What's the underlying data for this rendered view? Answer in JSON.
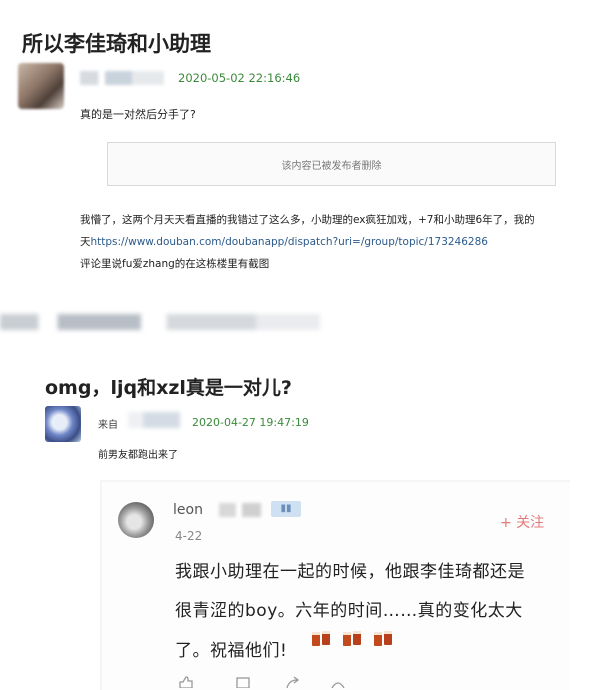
{
  "post1": {
    "title": "所以李佳琦和小助理",
    "timestamp": "2020-05-02 22:16:46",
    "comment": "真的是一对然后分手了?",
    "deleted_notice": "该内容已被发布者删除",
    "body_lines": [
      {
        "text": "我懵了，这两个月天天看直播的我错过了这么多，小助理的ex疯狂加戏，+7和小助理6年了，我的",
        "link": ""
      },
      {
        "text": "天",
        "link": "https://www.douban.com/doubanapp/dispatch?uri=/group/topic/173246286"
      },
      {
        "text": "评论里说fu爱zhang的在这栋楼里有截图",
        "link": ""
      }
    ]
  },
  "post2": {
    "title": "omg，ljq和xzl真是一对儿?",
    "from_label": "来自",
    "timestamp": "2020-04-27 19:47:19",
    "comment": "前男友都跑出来了"
  },
  "embedded_comment": {
    "username": "leon",
    "date": "4-22",
    "follow_label": "+ 关注",
    "lines": [
      "我跟小助理在一起的时候，他跟李佳琦都还是",
      "很青涩的boy。六年的时间……真的变化太大",
      "了。祝福他们!"
    ]
  },
  "colors": {
    "timestamp_green": "#3a8a3a",
    "link_blue": "#2b5a8c",
    "follow_red": "#e27a7a"
  },
  "icons": [
    "beer-cheers-emoji",
    "like-icon",
    "comment-icon",
    "share-icon",
    "more-icon"
  ]
}
